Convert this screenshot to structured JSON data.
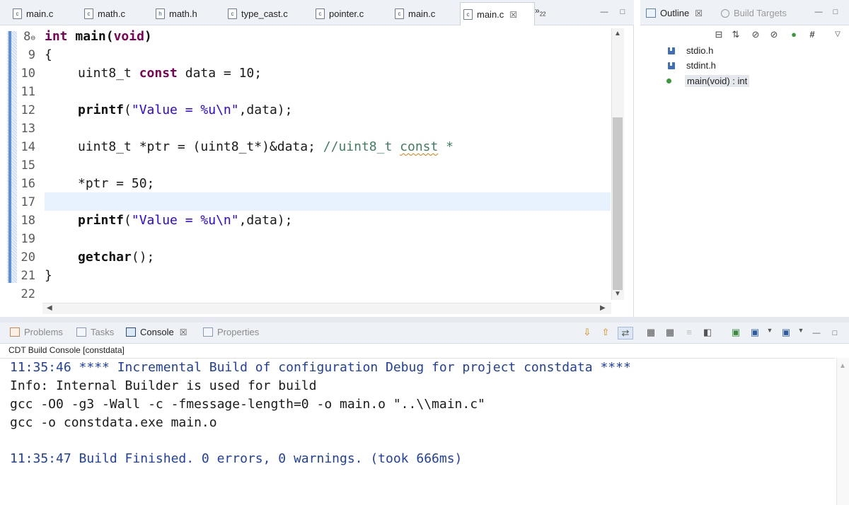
{
  "editor": {
    "tabs": [
      {
        "label": "main.c",
        "active": false
      },
      {
        "label": "math.c",
        "active": false
      },
      {
        "label": "math.h",
        "active": false
      },
      {
        "label": "type_cast.c",
        "active": false
      },
      {
        "label": "pointer.c",
        "active": false
      },
      {
        "label": "main.c",
        "active": false
      },
      {
        "label": "main.c",
        "active": true
      }
    ],
    "tab_close_glyph": "☒",
    "more_tabs": "»",
    "more_tabs_count": "22",
    "lines": [
      {
        "num": "8"
      },
      {
        "num": "9"
      },
      {
        "num": "10"
      },
      {
        "num": "11"
      },
      {
        "num": "12"
      },
      {
        "num": "13"
      },
      {
        "num": "14"
      },
      {
        "num": "15"
      },
      {
        "num": "16"
      },
      {
        "num": "17"
      },
      {
        "num": "18"
      },
      {
        "num": "19"
      },
      {
        "num": "20"
      },
      {
        "num": "21"
      },
      {
        "num": "22"
      }
    ],
    "code": {
      "l8_kw": "int",
      "l8_fn": "main",
      "l8_rest": "(",
      "l8_kw2": "void",
      "l8_end": ")",
      "l9": "{",
      "l10_type": "uint8_t ",
      "l10_kw": "const",
      "l10_rest": " data = 10;",
      "l12_fn": "printf",
      "l12_open": "(",
      "l12_str": "\"Value = %u\\n\"",
      "l12_rest": ",data);",
      "l14_code": "uint8_t *ptr = (uint8_t*)&data; ",
      "l14_comment": "//uint8_t ",
      "l14_squig": "const",
      "l14_comment2": " *",
      "l16": "*ptr = 50;",
      "l18_fn": "printf",
      "l18_open": "(",
      "l18_str": "\"Value = %u\\n\"",
      "l18_rest": ",data);",
      "l20_fn": "getchar",
      "l20_rest": "();",
      "l21": "}"
    }
  },
  "outline": {
    "tabs": [
      {
        "label": "Outline",
        "active": true
      },
      {
        "label": "Build Targets",
        "active": false
      }
    ],
    "items": [
      {
        "label": "stdio.h",
        "icon": "header-file-icon"
      },
      {
        "label": "stdint.h",
        "icon": "header-file-icon"
      },
      {
        "label": "main(void) : int",
        "icon": "function-icon",
        "selected": true
      }
    ]
  },
  "bottom": {
    "tabs": [
      {
        "label": "Problems",
        "active": false
      },
      {
        "label": "Tasks",
        "active": false
      },
      {
        "label": "Console",
        "active": true
      },
      {
        "label": "Properties",
        "active": false
      }
    ],
    "console_title": "CDT Build Console [constdata]",
    "console_lines": [
      {
        "text": "11:35:46 **** Incremental Build of configuration Debug for project constdata ****",
        "color": "blue"
      },
      {
        "text": "Info: Internal Builder is used for build",
        "color": "black"
      },
      {
        "text": "gcc -O0 -g3 -Wall -c -fmessage-length=0 -o main.o \"..\\\\main.c\"",
        "color": "black"
      },
      {
        "text": "gcc -o constdata.exe main.o",
        "color": "black"
      },
      {
        "text": "",
        "color": "black"
      },
      {
        "text": "11:35:47 Build Finished. 0 errors, 0 warnings. (took 666ms)",
        "color": "blue"
      }
    ]
  },
  "colors": {
    "keyword": "#7f0055",
    "string": "#2a00ff",
    "comment": "#3f7f5f",
    "console_blue": "#1f3fa8",
    "current_line": "#e8f2fe"
  }
}
